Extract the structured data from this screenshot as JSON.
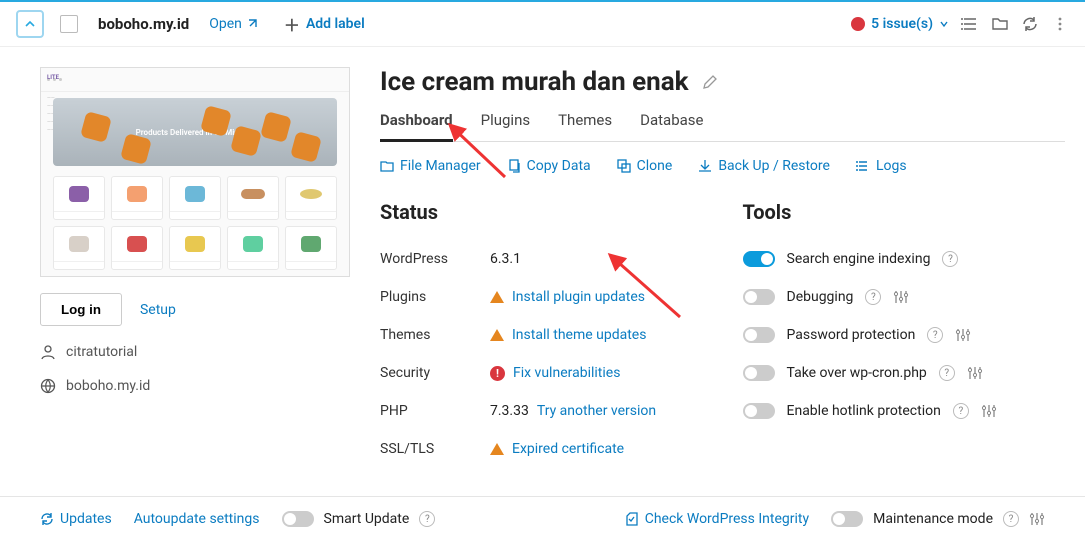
{
  "topbar": {
    "domain": "boboho.my.id",
    "open": "Open",
    "add_label": "Add label",
    "issues_count": "5 issue(s)"
  },
  "left": {
    "hero_text": "Products Delivered in 90 Minutes",
    "login": "Log in",
    "setup": "Setup",
    "user": "citratutorial",
    "site": "boboho.my.id"
  },
  "title": "Ice cream murah dan enak",
  "tabs": {
    "dashboard": "Dashboard",
    "plugins": "Plugins",
    "themes": "Themes",
    "database": "Database"
  },
  "actions": {
    "file_manager": "File Manager",
    "copy_data": "Copy Data",
    "clone": "Clone",
    "backup": "Back Up / Restore",
    "logs": "Logs"
  },
  "status": {
    "heading": "Status",
    "wordpress_label": "WordPress",
    "wordpress_value": "6.3.1",
    "plugins_label": "Plugins",
    "plugins_action": "Install plugin updates",
    "themes_label": "Themes",
    "themes_action": "Install theme updates",
    "security_label": "Security",
    "security_action": "Fix vulnerabilities",
    "php_label": "PHP",
    "php_value": "7.3.33",
    "php_action": "Try another version",
    "ssl_label": "SSL/TLS",
    "ssl_action": "Expired certificate"
  },
  "tools": {
    "heading": "Tools",
    "sei": "Search engine indexing",
    "debug": "Debugging",
    "pwd": "Password protection",
    "cron": "Take over wp-cron.php",
    "hotlink": "Enable hotlink protection"
  },
  "footer": {
    "updates": "Updates",
    "autoupdate": "Autoupdate settings",
    "smart": "Smart Update",
    "check": "Check WordPress Integrity",
    "maint": "Maintenance mode"
  }
}
